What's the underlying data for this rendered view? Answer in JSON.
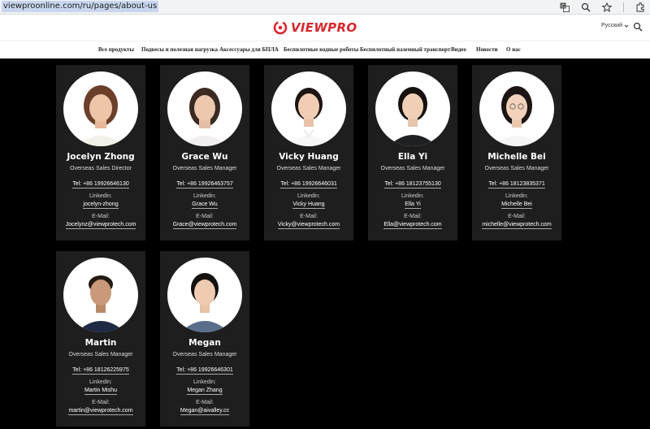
{
  "browser": {
    "url": "viewproonline.com/ru/pages/about-us",
    "icons": [
      "translate-icon",
      "zoom-icon",
      "star-icon",
      "extensions-icon"
    ]
  },
  "header": {
    "logo_text": "VIEWPRO",
    "language": "Русский",
    "brand_color": "#d8262c"
  },
  "nav": {
    "items": [
      {
        "label": "Все продукты"
      },
      {
        "label": "Подвесы и полезная нагрузка"
      },
      {
        "label": "Аксессуары для БПЛА"
      },
      {
        "label": "Беспилотные водные роботы"
      },
      {
        "label": "Беспилотный наземный транспорт"
      },
      {
        "label": "Видео"
      },
      {
        "label": "Новости"
      },
      {
        "label": "О нас"
      }
    ]
  },
  "team": {
    "members": [
      {
        "name": "Jocelyn Zhong",
        "title": "Overseas Sales Director",
        "tel": "Tel: +86 19926646130",
        "linkedin_label": "Linkedin:",
        "linkedin": "jocelyn-zhong",
        "email_label": "E-Mail:",
        "email": "Jocelynz@viewprotech.com"
      },
      {
        "name": "Grace Wu",
        "title": "Overseas Sales Manager",
        "tel": "Tel: +86 19926463757",
        "linkedin_label": "Linkedin:",
        "linkedin": "Grace Wu",
        "email_label": "E-Mail:",
        "email": "Grace@viewprotech.com"
      },
      {
        "name": "Vicky Huang",
        "title": "Overseas Sales Manager",
        "tel": "Tel: +86 19926646031",
        "linkedin_label": "Linkedin:",
        "linkedin": "Vicky Huang",
        "email_label": "E-Mail:",
        "email": "Vicky@viewprotech.com"
      },
      {
        "name": "Ella Yi",
        "title": "Overseas Sales Manager",
        "tel": "Tel: +86 18123755130",
        "linkedin_label": "Linkedin:",
        "linkedin": "Ella Yi",
        "email_label": "E-Mail:",
        "email": "Ella@viewprotech.com"
      },
      {
        "name": "Michelle Bei",
        "title": "Overseas Sales Manager",
        "tel": "Tel: +86 18123835371",
        "linkedin_label": "Linkedin:",
        "linkedin": "Michelle Bei",
        "email_label": "E-Mail:",
        "email": "michelle@viewprotech.com"
      },
      {
        "name": "Martin",
        "title": "Overseas Sales Manager",
        "tel": "Tel: +86 18126225975",
        "linkedin_label": "Linkedin:",
        "linkedin": "Martin Mishu",
        "email_label": "E-Mail:",
        "email": "martin@viewprotech.com"
      },
      {
        "name": "Megan",
        "title": "Overseas Sales Manager",
        "tel": "Tel: +86 19926646301",
        "linkedin_label": "Linkedin:",
        "linkedin": "Megan Zhang",
        "email_label": "E-Mail:",
        "email": "Megan@aivalley.cc"
      }
    ]
  }
}
